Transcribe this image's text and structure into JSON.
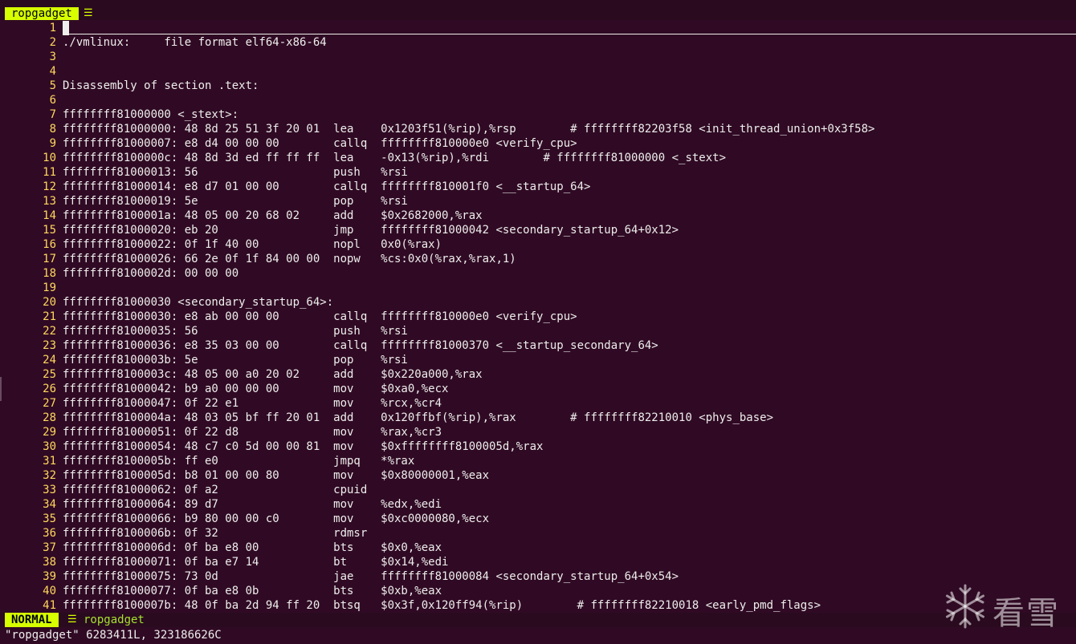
{
  "tabline": {
    "active_tab": "ropgadget",
    "tab_icon": "file-icon"
  },
  "editor": {
    "lines": [
      {
        "n": "1",
        "text": ""
      },
      {
        "n": "2",
        "text": "./vmlinux:     file format elf64-x86-64"
      },
      {
        "n": "3",
        "text": ""
      },
      {
        "n": "4",
        "text": ""
      },
      {
        "n": "5",
        "text": "Disassembly of section .text:"
      },
      {
        "n": "6",
        "text": ""
      },
      {
        "n": "7",
        "text": "ffffffff81000000 <_stext>:"
      },
      {
        "n": "8",
        "text": "ffffffff81000000: 48 8d 25 51 3f 20 01  lea    0x1203f51(%rip),%rsp        # ffffffff82203f58 <init_thread_union+0x3f58>"
      },
      {
        "n": "9",
        "text": "ffffffff81000007: e8 d4 00 00 00        callq  ffffffff810000e0 <verify_cpu>"
      },
      {
        "n": "10",
        "text": "ffffffff8100000c: 48 8d 3d ed ff ff ff  lea    -0x13(%rip),%rdi        # ffffffff81000000 <_stext>"
      },
      {
        "n": "11",
        "text": "ffffffff81000013: 56                    push   %rsi"
      },
      {
        "n": "12",
        "text": "ffffffff81000014: e8 d7 01 00 00        callq  ffffffff810001f0 <__startup_64>"
      },
      {
        "n": "13",
        "text": "ffffffff81000019: 5e                    pop    %rsi"
      },
      {
        "n": "14",
        "text": "ffffffff8100001a: 48 05 00 20 68 02     add    $0x2682000,%rax"
      },
      {
        "n": "15",
        "text": "ffffffff81000020: eb 20                 jmp    ffffffff81000042 <secondary_startup_64+0x12>"
      },
      {
        "n": "16",
        "text": "ffffffff81000022: 0f 1f 40 00           nopl   0x0(%rax)"
      },
      {
        "n": "17",
        "text": "ffffffff81000026: 66 2e 0f 1f 84 00 00  nopw   %cs:0x0(%rax,%rax,1)"
      },
      {
        "n": "18",
        "text": "ffffffff8100002d: 00 00 00"
      },
      {
        "n": "19",
        "text": ""
      },
      {
        "n": "20",
        "text": "ffffffff81000030 <secondary_startup_64>:"
      },
      {
        "n": "21",
        "text": "ffffffff81000030: e8 ab 00 00 00        callq  ffffffff810000e0 <verify_cpu>"
      },
      {
        "n": "22",
        "text": "ffffffff81000035: 56                    push   %rsi"
      },
      {
        "n": "23",
        "text": "ffffffff81000036: e8 35 03 00 00        callq  ffffffff81000370 <__startup_secondary_64>"
      },
      {
        "n": "24",
        "text": "ffffffff8100003b: 5e                    pop    %rsi"
      },
      {
        "n": "25",
        "text": "ffffffff8100003c: 48 05 00 a0 20 02     add    $0x220a000,%rax"
      },
      {
        "n": "26",
        "text": "ffffffff81000042: b9 a0 00 00 00        mov    $0xa0,%ecx"
      },
      {
        "n": "27",
        "text": "ffffffff81000047: 0f 22 e1              mov    %rcx,%cr4"
      },
      {
        "n": "28",
        "text": "ffffffff8100004a: 48 03 05 bf ff 20 01  add    0x120ffbf(%rip),%rax        # ffffffff82210010 <phys_base>"
      },
      {
        "n": "29",
        "text": "ffffffff81000051: 0f 22 d8              mov    %rax,%cr3"
      },
      {
        "n": "30",
        "text": "ffffffff81000054: 48 c7 c0 5d 00 00 81  mov    $0xffffffff8100005d,%rax"
      },
      {
        "n": "31",
        "text": "ffffffff8100005b: ff e0                 jmpq   *%rax"
      },
      {
        "n": "32",
        "text": "ffffffff8100005d: b8 01 00 00 80        mov    $0x80000001,%eax"
      },
      {
        "n": "33",
        "text": "ffffffff81000062: 0f a2                 cpuid"
      },
      {
        "n": "34",
        "text": "ffffffff81000064: 89 d7                 mov    %edx,%edi"
      },
      {
        "n": "35",
        "text": "ffffffff81000066: b9 80 00 00 c0        mov    $0xc0000080,%ecx"
      },
      {
        "n": "36",
        "text": "ffffffff8100006b: 0f 32                 rdmsr"
      },
      {
        "n": "37",
        "text": "ffffffff8100006d: 0f ba e8 00           bts    $0x0,%eax"
      },
      {
        "n": "38",
        "text": "ffffffff81000071: 0f ba e7 14           bt     $0x14,%edi"
      },
      {
        "n": "39",
        "text": "ffffffff81000075: 73 0d                 jae    ffffffff81000084 <secondary_startup_64+0x54>"
      },
      {
        "n": "40",
        "text": "ffffffff81000077: 0f ba e8 0b           bts    $0xb,%eax"
      },
      {
        "n": "41",
        "text": "ffffffff8100007b: 48 0f ba 2d 94 ff 20  btsq   $0x3f,0x120ff94(%rip)        # ffffffff82210018 <early_pmd_flags>"
      }
    ]
  },
  "statusline": {
    "mode": "NORMAL",
    "filename": "ropgadget",
    "icon": "file-icon"
  },
  "message": "\"ropgadget\" 6283411L, 323186626C",
  "watermark": {
    "text": "看雪",
    "icon": "snowflake-icon"
  },
  "colors": {
    "background": "#300a24",
    "line_number": "#ffd75f",
    "mode_badge": "#d7ff00",
    "status_filename": "#a6e22e"
  }
}
